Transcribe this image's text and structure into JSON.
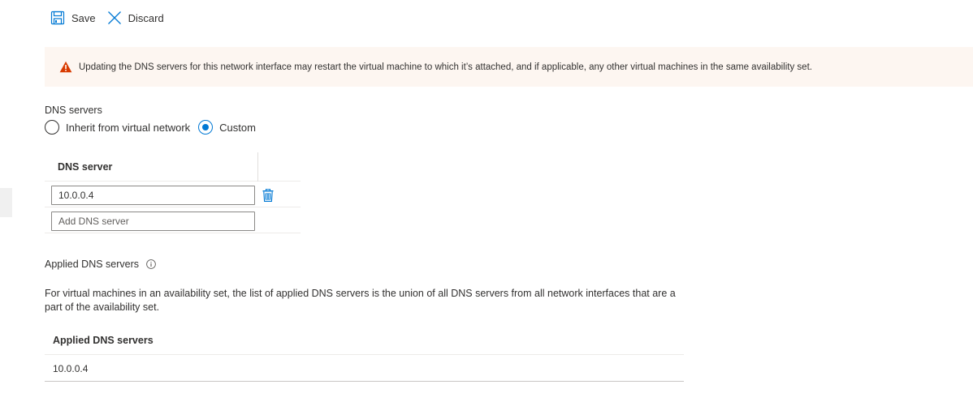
{
  "toolbar": {
    "save_label": "Save",
    "discard_label": "Discard"
  },
  "warning": {
    "text": "Updating the DNS servers for this network interface may restart the virtual machine to which it’s attached, and if applicable, any other virtual machines in the same availability set."
  },
  "dns_servers": {
    "label": "DNS servers",
    "options": [
      {
        "label": "Inherit from virtual network",
        "selected": false
      },
      {
        "label": "Custom",
        "selected": true
      }
    ],
    "table": {
      "header": "DNS server",
      "rows": [
        "10.0.0.4"
      ],
      "add_placeholder": "Add DNS server"
    }
  },
  "applied": {
    "label": "Applied DNS servers",
    "description": "For virtual machines in an availability set, the list of applied DNS servers is the union of all DNS servers from all network interfaces that are a part of the availability set.",
    "table": {
      "header": "Applied DNS servers",
      "rows": [
        "10.0.0.4"
      ]
    }
  },
  "colors": {
    "accent": "#0078d4",
    "warning_bg": "#fdf6f1",
    "warning_icon": "#d83b01"
  },
  "icons": {
    "save": "save-icon",
    "discard": "close-icon",
    "warning": "warning-icon",
    "delete": "trash-icon",
    "info": "info-icon"
  }
}
